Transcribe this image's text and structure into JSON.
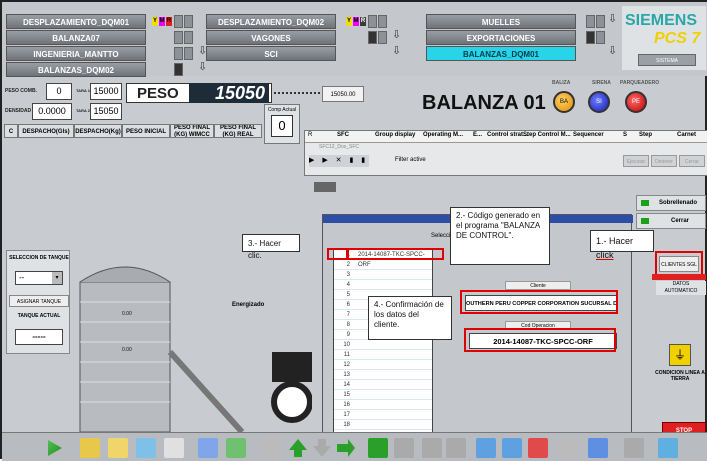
{
  "nav": {
    "row1": [
      "DESPLAZAMIENTO_DQM01",
      "DESPLAZAMIENTO_DQM02",
      "MUELLES"
    ],
    "row2": [
      "BALANZA07",
      "VAGONES",
      "EXPORTACIONES"
    ],
    "row3": [
      "INGENIERIA_MANTTO",
      "SCI",
      "BALANZAS_DQM01"
    ],
    "row4": [
      "BALANZAS_DQM02"
    ],
    "indicators": [
      "Y",
      "M",
      "R"
    ],
    "arrow": "⇩"
  },
  "brand": {
    "siemens": "SIEMENS",
    "pcs7": "PCS 7",
    "sistema": "SISTEMA"
  },
  "weights": {
    "rows": [
      {
        "label": "PESO COMB.",
        "value": "0",
        "tara": "TARA 1",
        "tara_value": "15000"
      },
      {
        "label": "DENSIDAD",
        "value": "0.0000",
        "tara": "TARA 2",
        "tara_value": "15050"
      }
    ],
    "peso_label": "PESO",
    "peso_value": "15050",
    "mini_readout": "15050.00",
    "comp_actual_label": "Comp Actual",
    "comp_actual_value": "0"
  },
  "table_headers": [
    "C",
    "DESPACHO(Gls)",
    "DESPACHO(Kg)",
    "PESO INICIAL (KG)",
    "PESO FINAL (KG) WIMCC",
    "PESO FINAL (KG) REAL"
  ],
  "title": "BALANZA 01",
  "lamps": {
    "labels": [
      "BALIZA",
      "SIRENA",
      "PARQUEADERO"
    ],
    "texts": [
      "BA",
      "SI",
      "PE"
    ]
  },
  "sfc": {
    "headers": [
      "R",
      "SFC",
      "Group display",
      "Operating M...",
      "E...",
      "Control strat...",
      "Step Control M...",
      "Sequencer",
      "S",
      "Step",
      "Carnet"
    ],
    "row1": "SFC12_Dos_SFC",
    "filter": "Filter active",
    "btns": [
      "Ejecutar",
      "Detener",
      "Cerrar"
    ]
  },
  "right_buttons": {
    "sobrellenado": "Sobrellenado",
    "cerrar": "Cerrar",
    "clientes": "CLIENTES SGL",
    "datos": "DATOS AUTOMATICO",
    "condicion": "CONDICION LINEA A TIERRA",
    "stop": "STOP"
  },
  "left_panel": {
    "seleccion": "SELECCION DE TANQUE",
    "asignar": "ASIGNAR TANQUE",
    "tanque_actual": "TANQUE ACTUAL",
    "tanque_value": "-----",
    "energizado": "Energizado",
    "tank_values": [
      "0.00",
      "0.00"
    ]
  },
  "dialog": {
    "list_first": "2014-14087-TKC-SPCC-ORF",
    "row_numbers": [
      "1",
      "2",
      "3",
      "4",
      "5",
      "6",
      "7",
      "8",
      "9",
      "10",
      "11",
      "12",
      "13",
      "14",
      "15",
      "16",
      "17",
      "18"
    ],
    "cliente_label": "Cliente",
    "cliente_value": "OUTHERN PERU COPPER CORPORATION SUCURSAL DEL PER",
    "cod_label": "Cod Operacion",
    "cod_value": "2014-14087-TKC-SPCC-ORF",
    "seleccione": "Selecci..."
  },
  "callouts": {
    "c1a": "1.- Hacer ",
    "c1b": "click",
    "c2": "2.- Código generado en el programa \"BALANZA DE CONTROL\".",
    "c3": "3.- Hacer clic.",
    "c4": "4.- Confirmación de los datos del cliente."
  },
  "colors": {
    "accent_red": "#e00000",
    "cyan": "#28d4e8",
    "siemens": "#2aa6a6"
  }
}
